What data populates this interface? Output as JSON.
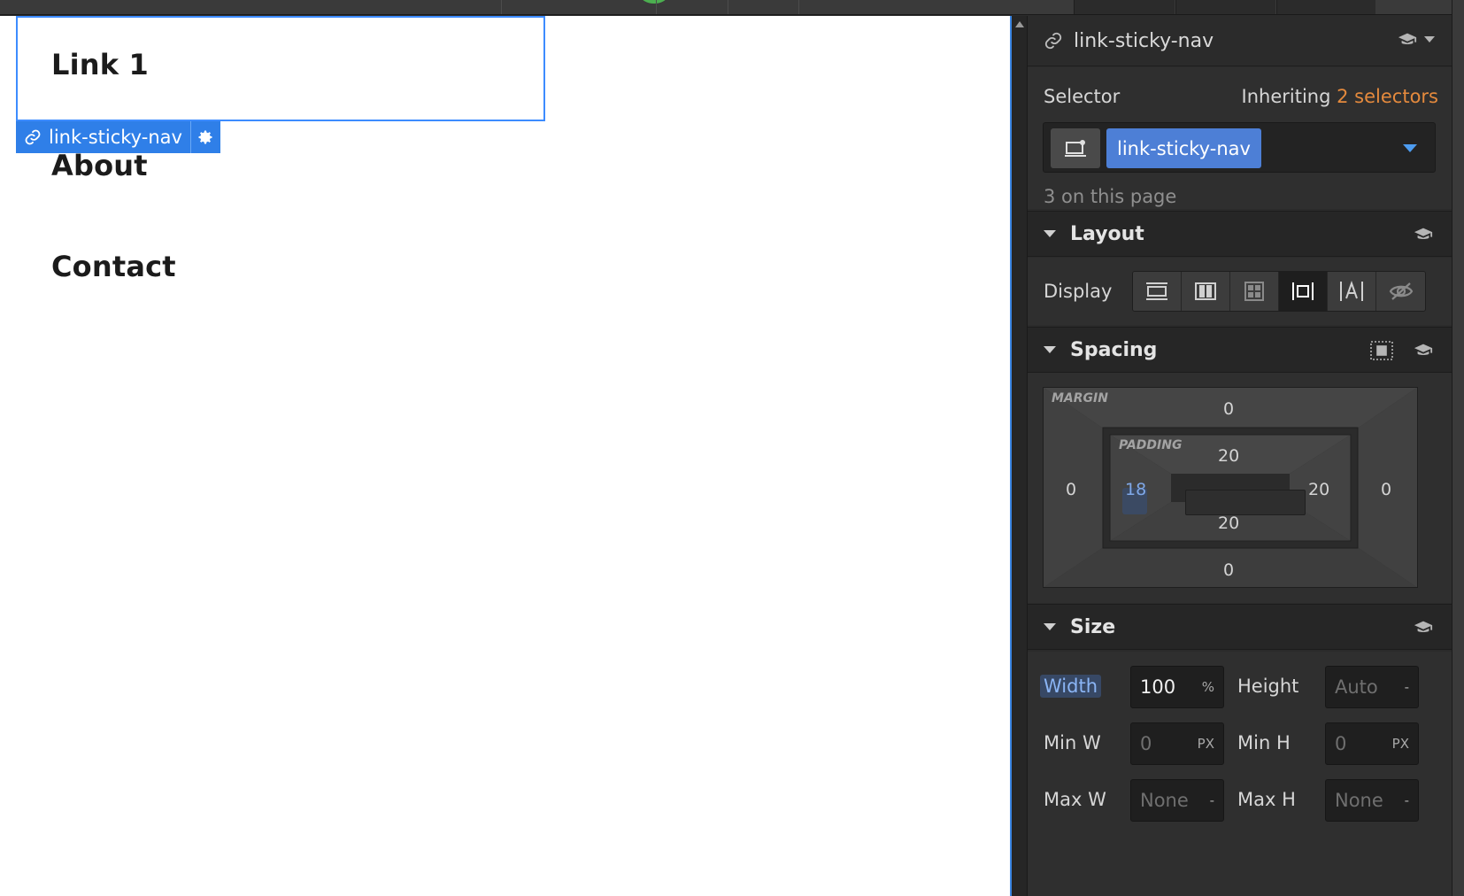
{
  "canvas": {
    "links": [
      "Link 1",
      "About",
      "Contact"
    ],
    "selected_badge": "link-sticky-nav"
  },
  "panel": {
    "element_name": "link-sticky-nav",
    "selector": {
      "label": "Selector",
      "inheriting_prefix": "Inheriting",
      "inheriting_count": "2 selectors",
      "chip": "link-sticky-nav",
      "on_page": "3 on this page"
    },
    "layout": {
      "title": "Layout",
      "display_label": "Display",
      "display_options": [
        "block-icon",
        "flex-icon",
        "grid-icon",
        "inline-block-icon",
        "inline-icon",
        "none-icon"
      ],
      "active_display": "inline-block-icon"
    },
    "spacing": {
      "title": "Spacing",
      "margin_label": "MARGIN",
      "padding_label": "PADDING",
      "margin": {
        "top": "0",
        "right": "0",
        "bottom": "0",
        "left": "0"
      },
      "padding": {
        "top": "20",
        "right": "20",
        "bottom": "20",
        "left": "18"
      }
    },
    "size": {
      "title": "Size",
      "width_label": "Width",
      "width_value": "100",
      "width_unit": "%",
      "height_label": "Height",
      "height_value": "Auto",
      "height_unit": "-",
      "minw_label": "Min W",
      "minw_value": "0",
      "minw_unit": "PX",
      "minh_label": "Min H",
      "minh_value": "0",
      "minh_unit": "PX",
      "maxw_label": "Max W",
      "maxw_value": "None",
      "maxw_unit": "-",
      "maxh_label": "Max H",
      "maxh_value": "None",
      "maxh_unit": "-"
    }
  },
  "colors": {
    "selection_blue": "#3d8cff",
    "chip_blue": "#4d7fd6",
    "accent_orange": "#e58a3d",
    "panel_bg": "#2b2b2b"
  }
}
